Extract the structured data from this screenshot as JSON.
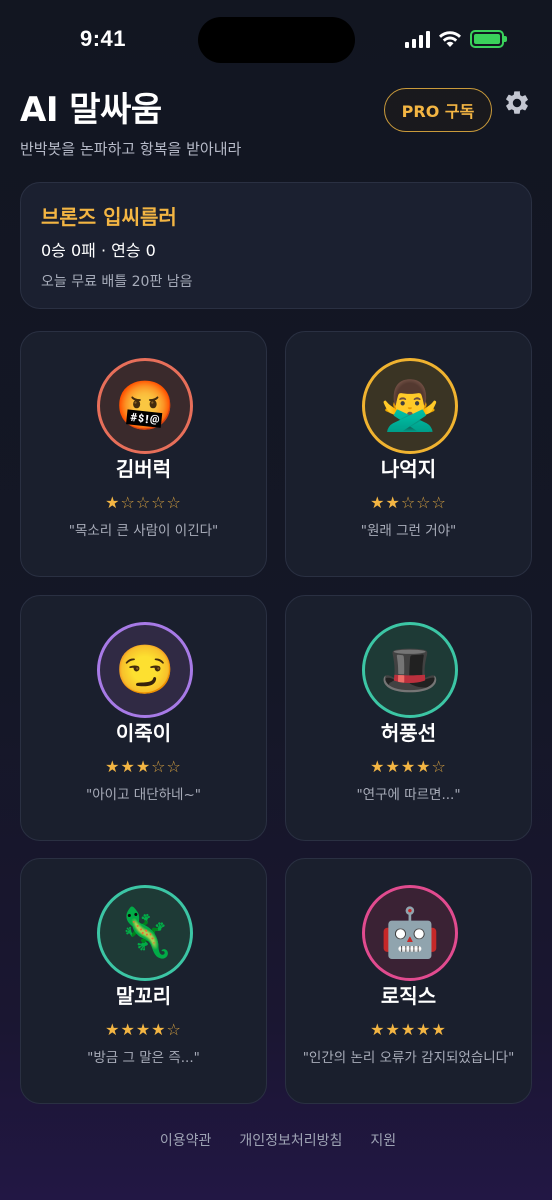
{
  "status_bar": {
    "time": "9:41"
  },
  "header": {
    "title": "AI 말싸움",
    "subtitle": "반박봇을 논파하고 항복을 받아내라",
    "pro_label": "PRO 구독",
    "settings_icon": "gear-icon"
  },
  "rank": {
    "title": "브론즈 입씨름러",
    "record": "0승 0패 · 연승 0",
    "remaining": "오늘 무료 배틀 20판 남음"
  },
  "opponents": [
    {
      "name": "김버럭",
      "emoji": "🤬",
      "ring_color": "#e76f5a",
      "avatar_bg": "#3a2a2c",
      "stars": 1,
      "max_stars": 5,
      "quote": "\"목소리 큰 사람이 이긴다\""
    },
    {
      "name": "나억지",
      "emoji": "🙅‍♂️",
      "ring_color": "#f0b330",
      "avatar_bg": "#3a3424",
      "stars": 2,
      "max_stars": 5,
      "quote": "\"원래 그런 거야\""
    },
    {
      "name": "이죽이",
      "emoji": "😏",
      "ring_color": "#a77ae6",
      "avatar_bg": "#302a44",
      "stars": 3,
      "max_stars": 5,
      "quote": "\"아이고 대단하네~\""
    },
    {
      "name": "허풍선",
      "emoji": "🎩",
      "ring_color": "#3cc6a5",
      "avatar_bg": "#1e3a36",
      "stars": 4,
      "max_stars": 5,
      "quote": "\"연구에 따르면...\""
    },
    {
      "name": "말꼬리",
      "emoji": "🦎",
      "ring_color": "#3cc6a5",
      "avatar_bg": "#1e3a36",
      "stars": 4,
      "max_stars": 5,
      "quote": "\"방금 그 말은 즉...\""
    },
    {
      "name": "로직스",
      "emoji": "🤖",
      "ring_color": "#e14b8f",
      "avatar_bg": "#3a2234",
      "stars": 5,
      "max_stars": 5,
      "quote": "\"인간의 논리 오류가 감지되었습니다\""
    }
  ],
  "footer": {
    "terms": "이용약관",
    "privacy": "개인정보처리방침",
    "support": "지원"
  }
}
